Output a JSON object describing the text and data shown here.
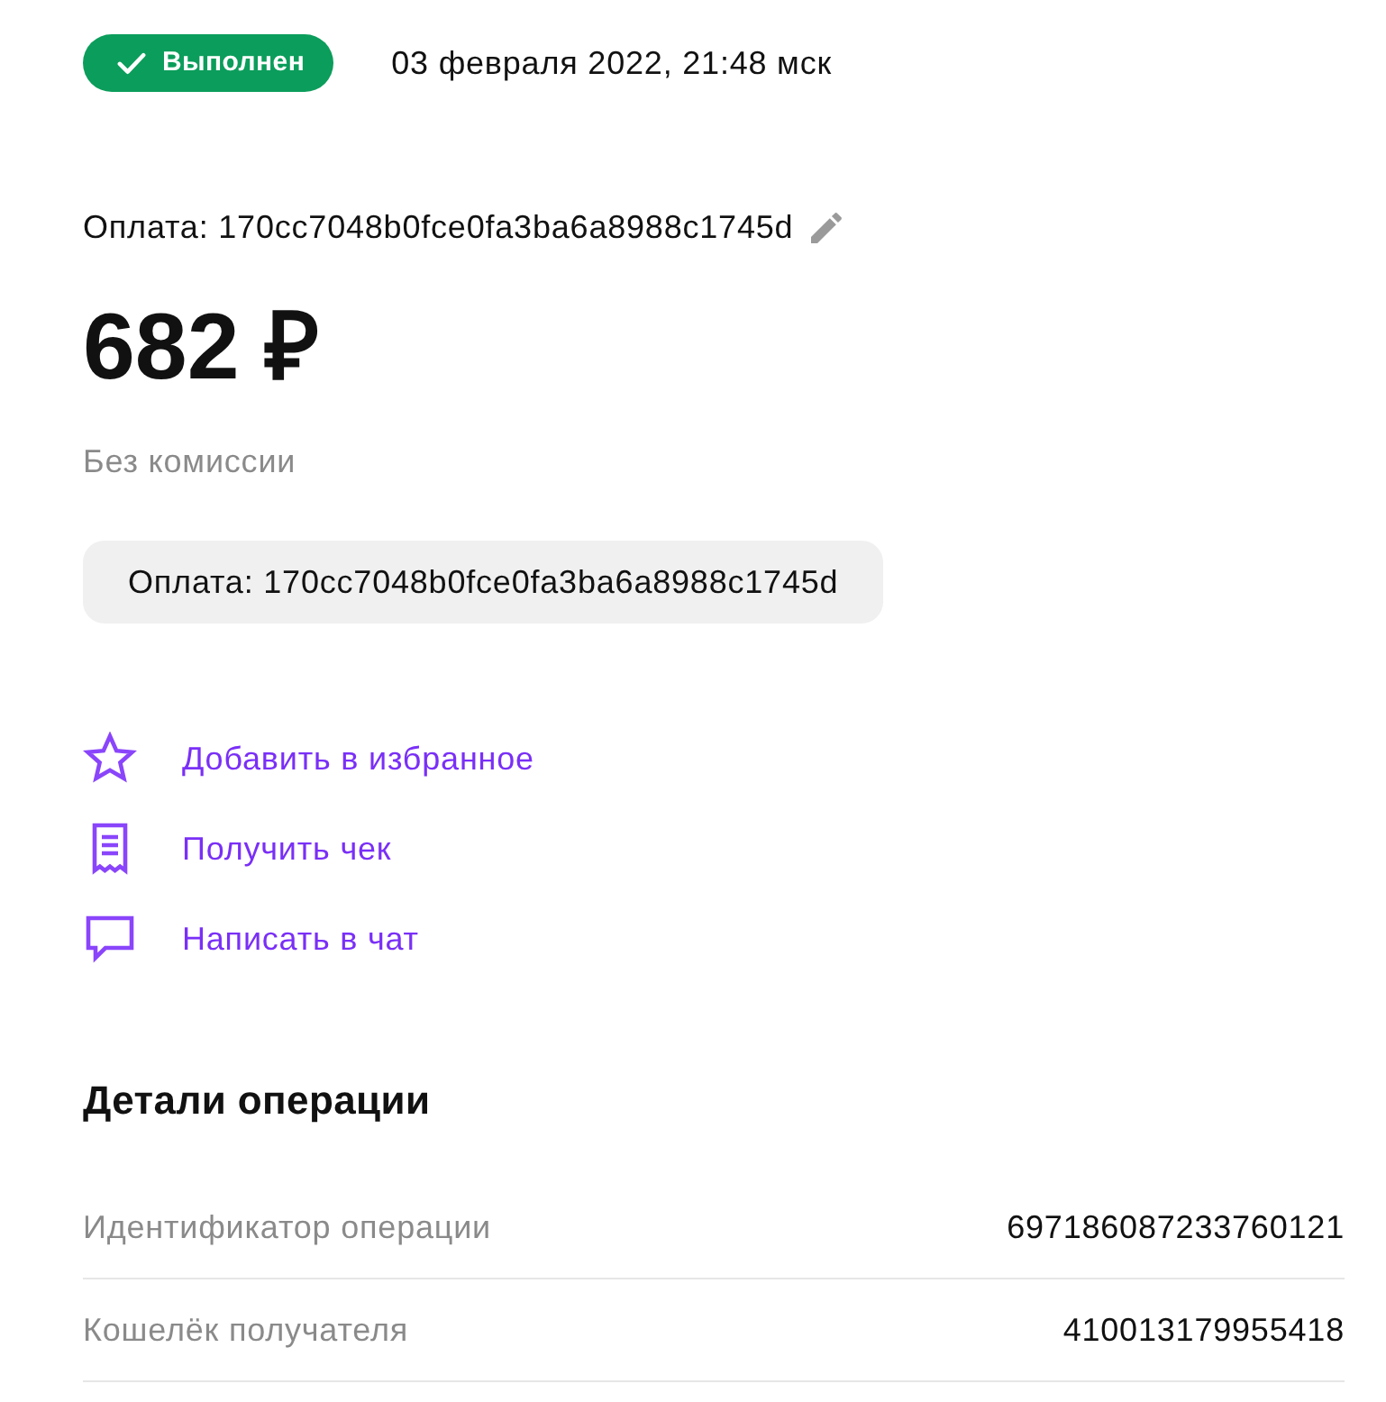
{
  "status": {
    "label": "Выполнен",
    "kind": "success"
  },
  "date": "03 февраля 2022, 21:48 мск",
  "title": "Оплата: 170cc7048b0fce0fa3ba6a8988c1745d",
  "amount": "682 ₽",
  "fee_note": "Без комиссии",
  "comment": "Оплата: 170cc7048b0fce0fa3ba6a8988c1745d",
  "actions": [
    {
      "label": "Добавить в избранное"
    },
    {
      "label": "Получить чек"
    },
    {
      "label": "Написать в чат"
    }
  ],
  "details": {
    "title": "Детали операции",
    "rows": [
      {
        "label": "Идентификатор операции",
        "value": "697186087233760121"
      },
      {
        "label": "Кошелёк получателя",
        "value": "410013179955418"
      }
    ]
  }
}
